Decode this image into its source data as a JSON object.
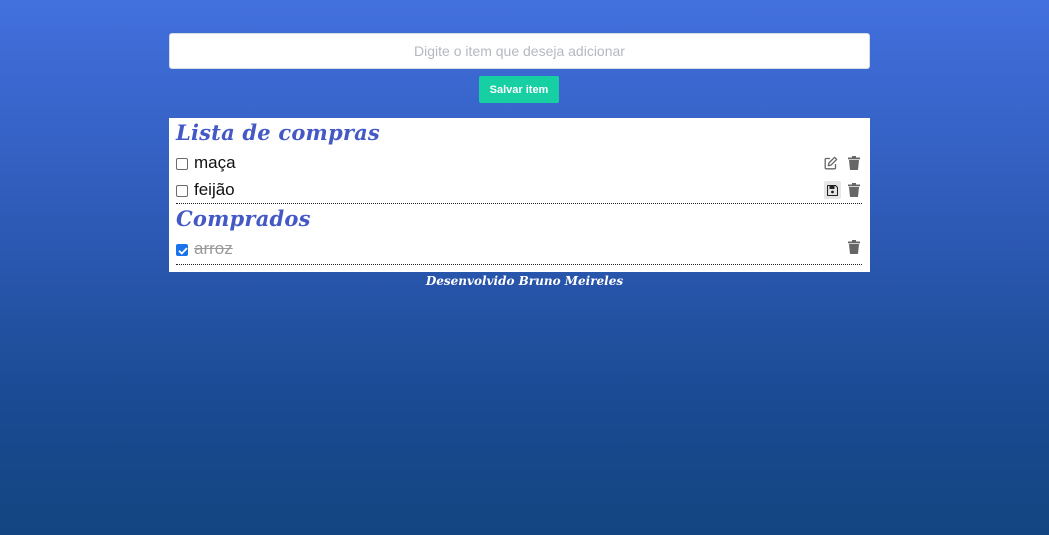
{
  "new_item": {
    "placeholder": "Digite o item que deseja adicionar",
    "value": "",
    "save_label": "Salvar item"
  },
  "shopping_list": {
    "title": "Lista de compras",
    "items": [
      {
        "label": "maça",
        "checked": false,
        "actions": [
          "edit-icon",
          "trash-icon"
        ]
      },
      {
        "label": "feijão",
        "checked": false,
        "actions": [
          "save-icon",
          "trash-icon"
        ]
      }
    ]
  },
  "purchased": {
    "title": "Comprados",
    "items": [
      {
        "label": "arroz",
        "checked": true,
        "actions": [
          "trash-icon"
        ]
      }
    ]
  },
  "footer": {
    "text": "Desenvolvido Bruno Meireles"
  },
  "colors": {
    "accent": "#16cfa3",
    "heading": "#4459c5",
    "background_top": "#4270de",
    "background_bottom": "#134581"
  }
}
